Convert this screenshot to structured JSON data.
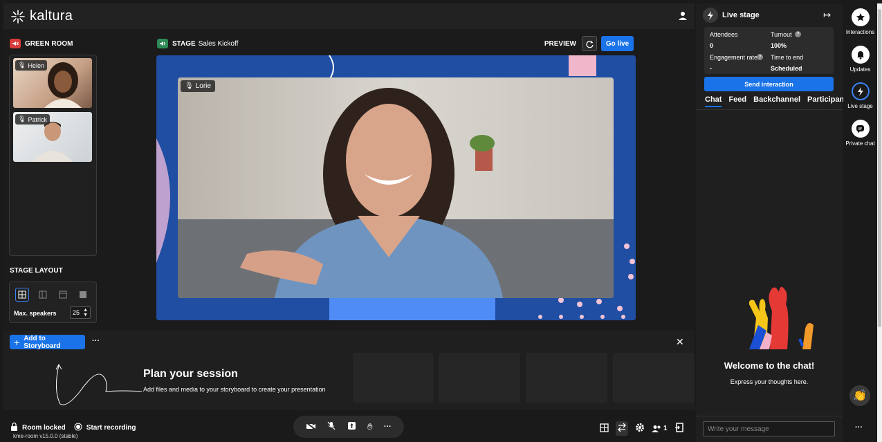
{
  "brand": {
    "name": "kaltura"
  },
  "green_room": {
    "label": "GREEN ROOM",
    "participants": [
      {
        "name": "Helen"
      },
      {
        "name": "Patrick"
      }
    ]
  },
  "stage": {
    "label": "STAGE",
    "title": "Sales Kickoff",
    "speaker": "Lorie",
    "preview_label": "PREVIEW",
    "go_live_label": "Go live"
  },
  "stage_layout": {
    "label": "STAGE LAYOUT",
    "max_speakers_label": "Max. speakers",
    "max_speakers_value": "25"
  },
  "storyboard": {
    "add_label": "Add to Storyboard",
    "more": "···",
    "plan_title": "Plan your session",
    "plan_subtitle": "Add files and media to your storyboard to create your presentation"
  },
  "bottom": {
    "room_locked": "Room locked",
    "start_recording": "Start recording",
    "version": "kme-room v15.0.0 (stable)",
    "participants_count": "1"
  },
  "side_panel": {
    "title": "Live stage",
    "stats": {
      "attendees_label": "Attendees",
      "attendees_value": "0",
      "turnout_label": "Turnout",
      "turnout_value": "100%",
      "engagement_label": "Engagement rate",
      "engagement_value": "-",
      "time_label": "Time to end",
      "time_value": "Scheduled"
    },
    "send_interaction": "Send interaction",
    "tabs": [
      "Chat",
      "Feed",
      "Backchannel",
      "Participants"
    ],
    "welcome_title": "Welcome to the chat!",
    "welcome_sub": "Express your thoughts here.",
    "chat_placeholder": "Write your message"
  },
  "rail": {
    "items": [
      {
        "label": "Interactions"
      },
      {
        "label": "Updates"
      },
      {
        "label": "Live stage"
      },
      {
        "label": "Private chat"
      }
    ],
    "more": "···"
  },
  "colors": {
    "accent": "#1a73e8",
    "green_room_red": "#d93b3b",
    "stage_green": "#2e8b57",
    "stage_blue": "#1f4ea3"
  }
}
